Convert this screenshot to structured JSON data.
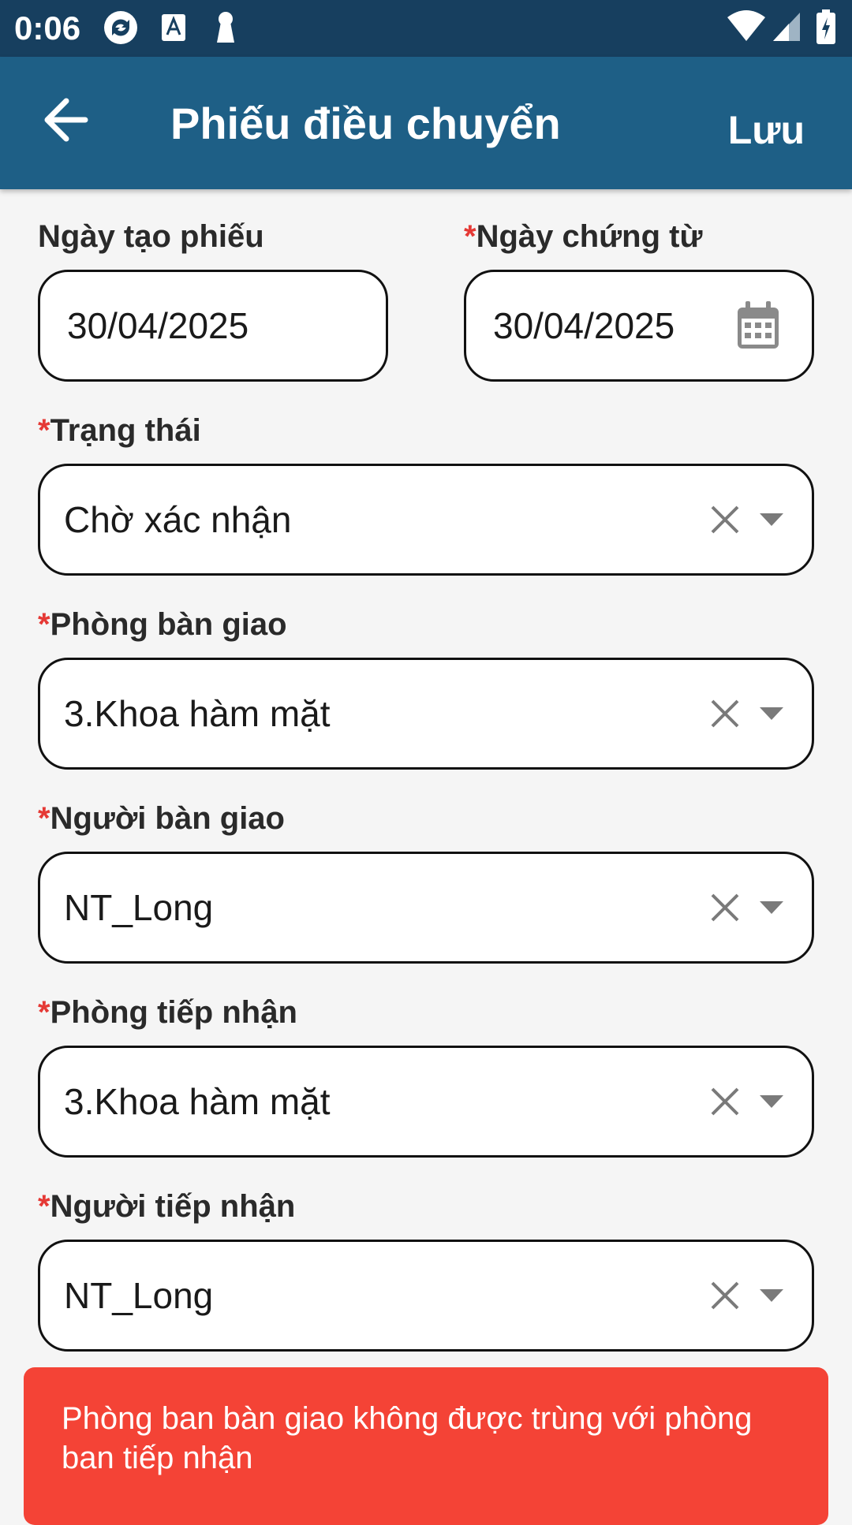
{
  "status_bar": {
    "time": "0:06",
    "icons": [
      "sync-icon",
      "font-icon",
      "keyhole-icon",
      "wifi-icon",
      "signal-icon",
      "battery-icon"
    ]
  },
  "app_bar": {
    "title": "Phiếu điều chuyển",
    "save_label": "Lưu",
    "back_icon": "arrow-left-icon",
    "color": "#1e5f86"
  },
  "form": {
    "created_date": {
      "label": "Ngày tạo phiếu",
      "value": "30/04/2025"
    },
    "document_date": {
      "required_mark": "*",
      "label": "Ngày chứng từ",
      "value": "30/04/2025",
      "icon": "calendar-icon"
    },
    "status": {
      "required_mark": "*",
      "label": "Trạng thái",
      "value": "Chờ xác nhận"
    },
    "handover_department": {
      "required_mark": "*",
      "label": "Phòng bàn giao",
      "value": "3.Khoa hàm mặt"
    },
    "handover_person": {
      "required_mark": "*",
      "label": "Người bàn giao",
      "value": "NT_Long"
    },
    "receiving_department": {
      "required_mark": "*",
      "label": "Phòng tiếp nhận",
      "value": "3.Khoa hàm mặt"
    },
    "receiving_person": {
      "required_mark": "*",
      "label": "Người tiếp nhận",
      "value": "NT_Long"
    }
  },
  "toast": {
    "message": "Phòng ban bàn giao không được trùng với phòng ban tiếp nhận",
    "color": "#f44336"
  },
  "colors": {
    "required": "#e53935",
    "status_bar": "#173f5f"
  }
}
